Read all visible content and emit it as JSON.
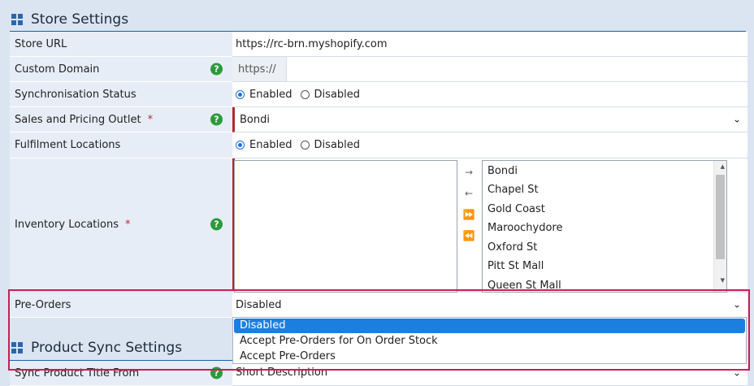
{
  "store_settings": {
    "title": "Store Settings",
    "store_url": {
      "label": "Store URL",
      "value": "https://rc-brn.myshopify.com"
    },
    "custom_domain": {
      "label": "Custom Domain",
      "prefix": "https://",
      "value": ""
    },
    "sync_status": {
      "label": "Synchronisation Status",
      "options": [
        "Enabled",
        "Disabled"
      ],
      "selected": "Enabled"
    },
    "sales_outlet": {
      "label": "Sales and Pricing Outlet",
      "required_mark": "*",
      "value": "Bondi"
    },
    "fulfilment": {
      "label": "Fulfilment Locations",
      "options": [
        "Enabled",
        "Disabled"
      ],
      "selected": "Enabled"
    },
    "inventory": {
      "label": "Inventory Locations",
      "required_mark": "*",
      "selected_items": [],
      "available_items": [
        "Bondi",
        "Chapel St",
        "Gold Coast",
        "Maroochydore",
        "Oxford St",
        "Pitt St Mall",
        "Queen St Mall"
      ],
      "move_buttons": [
        "→",
        "←",
        "⏩",
        "⏪"
      ]
    },
    "pre_orders": {
      "label": "Pre-Orders",
      "value": "Disabled",
      "options": [
        "Disabled",
        "Accept Pre-Orders for On Order Stock",
        "Accept Pre-Orders"
      ],
      "highlighted": "Disabled"
    }
  },
  "product_sync": {
    "title": "Product Sync Settings",
    "title_from": {
      "label": "Sync Product Title From",
      "value": "Short Description"
    }
  },
  "help_glyph": "?",
  "colors": {
    "accent": "#1f5fae",
    "required": "#b3262f",
    "help": "#2c9a3c",
    "selection": "#1c7fe0",
    "focus": "#c81f56"
  }
}
